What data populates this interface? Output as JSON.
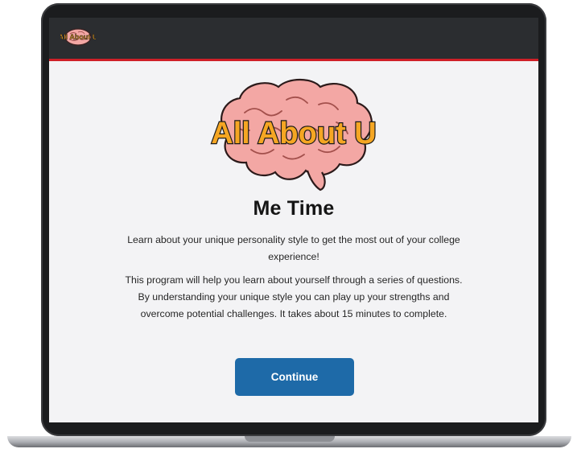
{
  "app": {
    "logo_text": "All About U"
  },
  "main": {
    "title": "Me Time",
    "intro": "Learn about your unique personality style to get the most out of your college experience!",
    "description": "This program will help you learn about yourself through a series of questions. By understanding your unique style you can play up your strengths and overcome potential challenges. It takes about 15 minutes to complete.",
    "continue_label": "Continue"
  },
  "colors": {
    "header_bg": "#2b2d30",
    "header_accent": "#cf2027",
    "button_bg": "#1e6aa8",
    "logo_text_fill": "#f5a623",
    "brain_fill": "#f3a7a4"
  }
}
